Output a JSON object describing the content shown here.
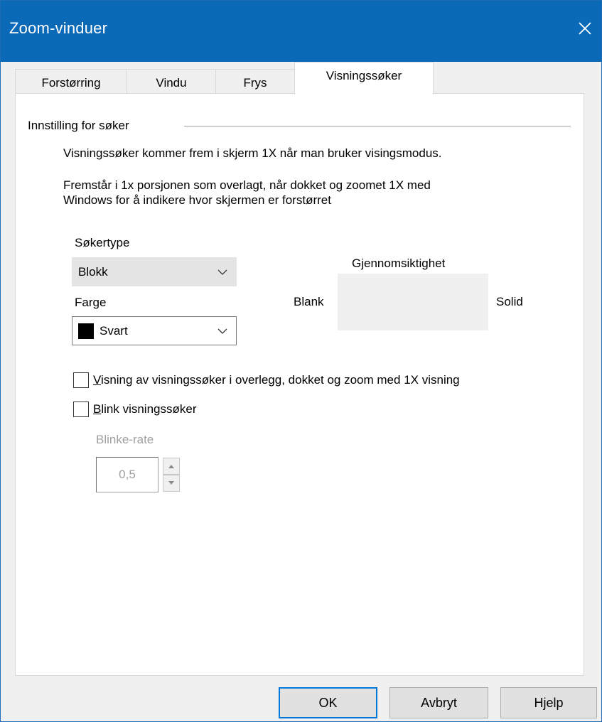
{
  "window": {
    "title": "Zoom-vinduer",
    "accent": "#0a6ab8"
  },
  "tabs": [
    {
      "label": "Forstørring",
      "active": false
    },
    {
      "label": "Vindu",
      "active": false
    },
    {
      "label": "Frys",
      "active": false
    },
    {
      "label": "Visningssøker",
      "active": true
    }
  ],
  "group": {
    "label": "Innstilling for søker",
    "description_1": "Visningssøker kommer frem i skjerm 1X når man bruker visingsmodus.",
    "description_2_line1": "Fremstår i 1x porsjonen som overlagt, når dokket og zoomet 1X med",
    "description_2_line2": "Windows for å indikere hvor skjermen er forstørret"
  },
  "finder_type": {
    "label": "Søkertype",
    "value": "Blokk"
  },
  "color": {
    "label": "Farge",
    "value": "Svart",
    "swatch": "#000000"
  },
  "transparency": {
    "label": "Gjennomsiktighet",
    "min_label": "Blank",
    "max_label": "Solid"
  },
  "options": {
    "show_overlay": {
      "access_key": "V",
      "rest": "isning av visningssøker i overlegg, dokket og zoom med 1X visning",
      "checked": false
    },
    "blink": {
      "access_key": "B",
      "rest": "link visningssøker",
      "checked": false
    }
  },
  "blink_rate": {
    "label": "Blinke-rate",
    "value": "0,5"
  },
  "buttons": {
    "ok": "OK",
    "cancel": "Avbryt",
    "help": "Hjelp"
  }
}
